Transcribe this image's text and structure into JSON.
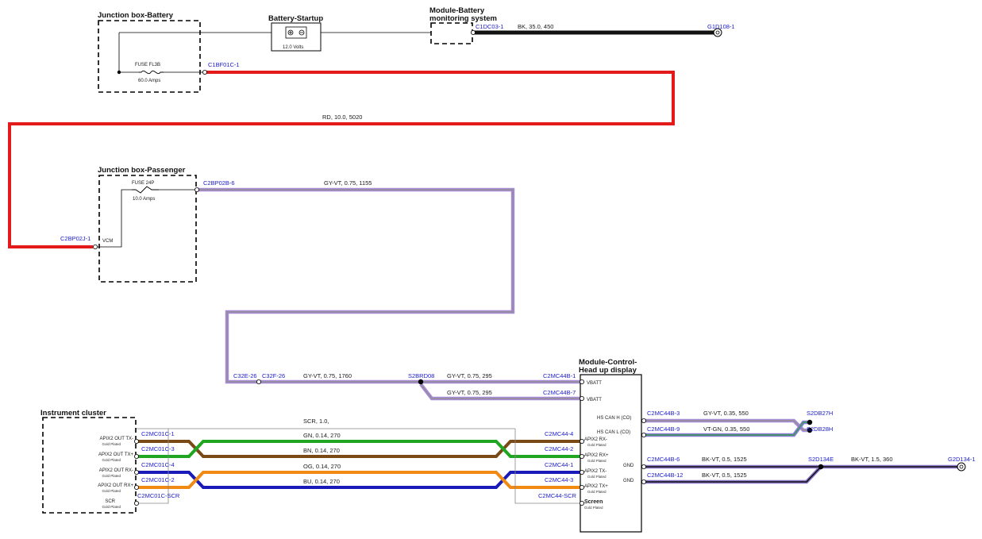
{
  "colors": {
    "red": "#e21a1a",
    "black": "#111111",
    "gray_violet_outer": "#a98bd8",
    "gray_violet_inner": "#8f8f8f",
    "green": "#1fa51f",
    "brown": "#7a4a16",
    "orange": "#f08a12",
    "blue": "#1a1ab8",
    "connector_text": "#1a1acc",
    "violet_green_outer": "#8e7ad8",
    "violet_green_inner": "#2f9e4a",
    "black_violet_outer": "#8a74c8",
    "black_violet_inner": "#111111"
  },
  "modules": {
    "jb_battery": "Junction box-Battery",
    "battery_startup": "Battery-Startup",
    "module_bms_line1": "Module-Battery",
    "module_bms_line2": "monitoring system",
    "jb_passenger": "Junction box-Passenger",
    "hud_line1": "Module-Control-",
    "hud_line2": "Head up display",
    "instrument_cluster": "Instrument cluster"
  },
  "battery_voltage": "12.0 Volts",
  "fuses": {
    "fl3b_name": "FUSE FL3B",
    "fl3b_rating": "60.0 Amps",
    "f24p_name": "FUSE 24P",
    "f24p_rating": "10.0 Amps"
  },
  "connectors": {
    "c1dc03": "C1DC03-1",
    "g1d108": "G1D108-1",
    "c1bf01c": "C1BF01C-1",
    "c2bp02j": "C2BP02J-1",
    "c2bp02b": "C2BP02B-6",
    "c32e": "C32E-26",
    "c32f": "C32F-26",
    "s2brd08": "S2BRD08",
    "c2mc44b_1": "C2MC44B-1",
    "c2mc44b_7": "C2MC44B-7",
    "c2mc01c_1": "C2MC01C-1",
    "c2mc01c_3": "C2MC01C-3",
    "c2mc01c_4": "C2MC01C-4",
    "c2mc01c_2": "C2MC01C-2",
    "c2mc01c_scr": "C2MC01C-SCR",
    "c2mc44_4": "C2MC44-4",
    "c2mc44_2": "C2MC44-2",
    "c2mc44_1": "C2MC44-1",
    "c2mc44_3": "C2MC44-3",
    "c2mc44_scr": "C2MC44-SCR",
    "c2mc44b_3": "C2MC44B-3",
    "c2mc44b_9": "C2MC44B-9",
    "c2mc44b_6": "C2MC44B-6",
    "c2mc44b_12": "C2MC44B-12",
    "s2db27h": "S2DB27H",
    "s2db28h": "S2DB28H",
    "s2d134e": "S2D134E",
    "g2d134": "G2D134-1"
  },
  "wires": {
    "bk_main": "BK,  35.0,  450",
    "rd_main": "RD,  10.0,  5020",
    "gyvt_1155": "GY-VT,  0.75,  1155",
    "gyvt_1760": "GY-VT,  0.75,  1760",
    "gyvt_295_a": "GY-VT,  0.75,  295",
    "gyvt_295_b": "GY-VT,  0.75,  295",
    "scr": "SCR,  1.0,",
    "gn": "GN,  0.14,  270",
    "bn": "BN,  0.14,  270",
    "og": "OG,  0.14,  270",
    "bu": "BU,  0.14,  270",
    "gyvt_550": "GY-VT,  0.35,  550",
    "vtgn_550": "VT-GN,  0.35,  550",
    "bkvt_1525_a": "BK-VT,  0.5,  1525",
    "bkvt_1525_b": "BK-VT,  0.5,  1525",
    "bkvt_360": "BK-VT,  1.5,  360"
  },
  "pins": {
    "vcm": "VCM",
    "vbatt_1": "VBATT",
    "vbatt_2": "VBATT",
    "hs_can_h": "HS CAN H (CO)",
    "hs_can_l": "HS CAN L (CO)",
    "gnd_1": "GND",
    "gnd_2": "GND",
    "hud_rx_minus": "APIX2 RX-",
    "hud_rx_plus": "APIX2 RX+",
    "hud_tx_minus": "APIX2 TX-",
    "hud_tx_plus": "APIX2 TX+",
    "hud_screen": "Screen",
    "ic_out_tx_minus": "APIX2 OUT TX-",
    "ic_out_tx_plus": "APIX2 OUT TX+",
    "ic_out_rx_minus": "APIX2 OUT RX-",
    "ic_out_rx_plus": "APIX2 OUT RX+",
    "ic_scr": "SCR",
    "gold_plated": "Gold Plated"
  }
}
